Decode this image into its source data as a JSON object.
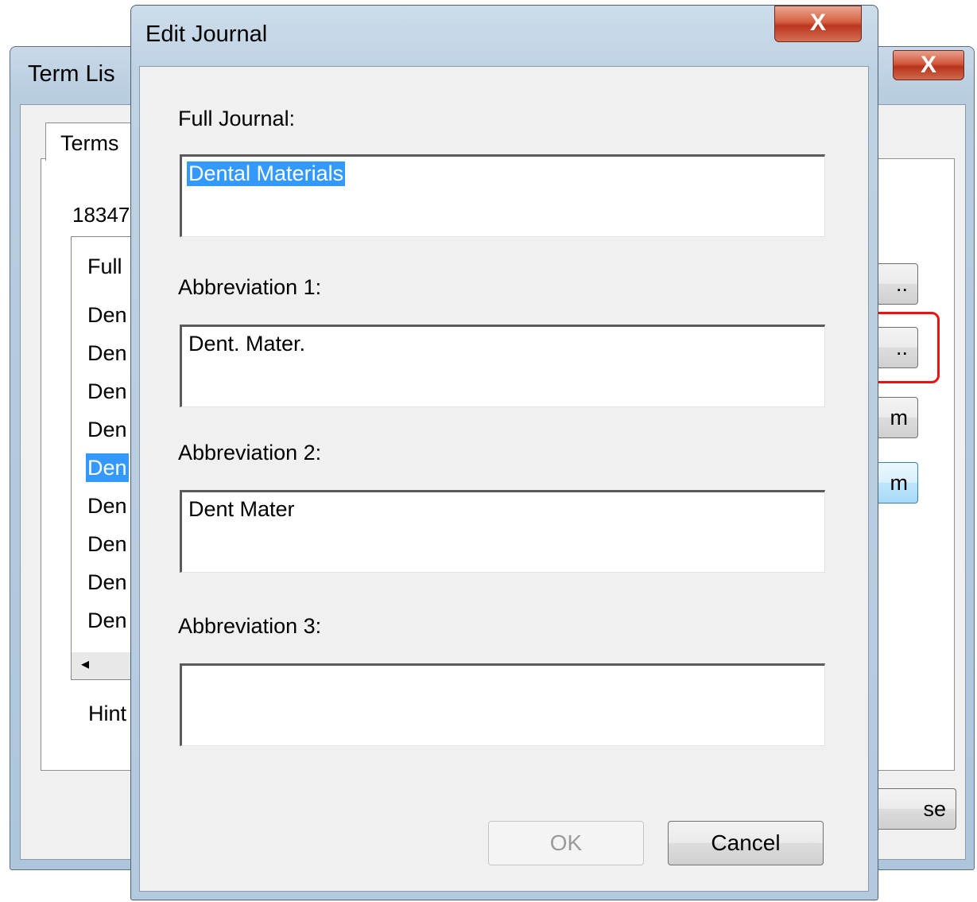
{
  "background_window": {
    "title": "Term Lis",
    "close_glyph": "X",
    "tab_label": "Terms",
    "count_text": "18347",
    "list_header": "Full",
    "rows": [
      "Den",
      "Den",
      "Den",
      "Den",
      "Den",
      "Den",
      "Den",
      "Den",
      "Den"
    ],
    "selected_row_index": 4,
    "scroll_left_glyph": "◂",
    "hint_text": "Hint",
    "buttons": [
      "..",
      "..",
      "m",
      "m",
      "se"
    ]
  },
  "dialog": {
    "title": "Edit Journal",
    "close_glyph": "X",
    "full_journal_label": "Full Journal:",
    "full_journal_value": "Dental Materials",
    "abbr1_label": "Abbreviation 1:",
    "abbr1_value": "Dent. Mater.",
    "abbr2_label": "Abbreviation 2:",
    "abbr2_value": "Dent Mater",
    "abbr3_label": "Abbreviation 3:",
    "abbr3_value": "",
    "ok_label": "OK",
    "cancel_label": "Cancel"
  },
  "colors": {
    "selection": "#3399ff",
    "highlight_annotation": "#ee1111",
    "close_button": "#c8442a"
  }
}
